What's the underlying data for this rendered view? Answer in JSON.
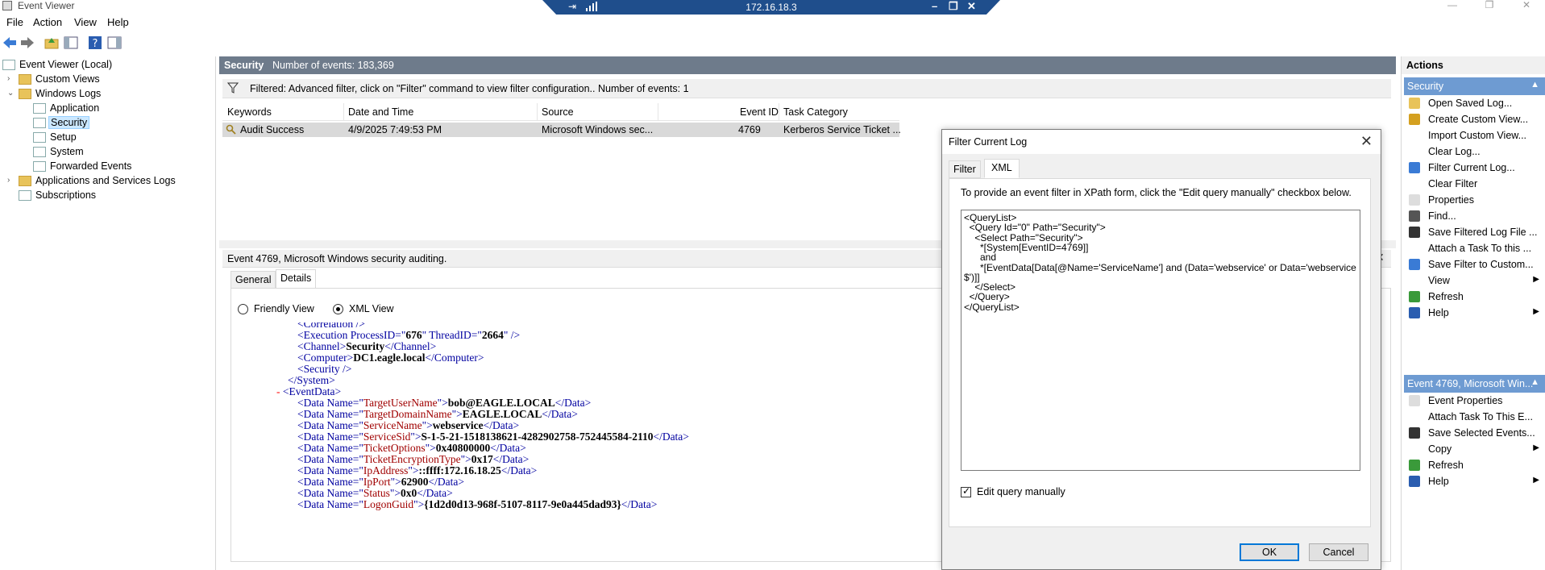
{
  "window": {
    "title": "Event Viewer"
  },
  "remote": {
    "host": "172.16.18.3"
  },
  "menu": [
    "File",
    "Action",
    "View",
    "Help"
  ],
  "tree": {
    "root": "Event Viewer (Local)",
    "custom_views": "Custom Views",
    "windows_logs": "Windows Logs",
    "application": "Application",
    "security": "Security",
    "setup": "Setup",
    "system": "System",
    "forwarded": "Forwarded Events",
    "apps_services": "Applications and Services Logs",
    "subscriptions": "Subscriptions"
  },
  "center": {
    "log_name": "Security",
    "count_text": "Number of events: 183,369",
    "filter_text": "Filtered: Advanced filter, click on \"Filter\" command to view filter configuration.. Number of events: 1",
    "columns": [
      "Keywords",
      "Date and Time",
      "Source",
      "Event ID",
      "Task Category"
    ],
    "row": {
      "keywords": "Audit Success",
      "date": "4/9/2025 7:49:53 PM",
      "source": "Microsoft Windows sec...",
      "event_id": "4769",
      "task": "Kerberos Service Ticket ..."
    }
  },
  "detail": {
    "header": "Event 4769, Microsoft Windows security auditing.",
    "tab_general": "General",
    "tab_details": "Details",
    "friendly": "Friendly View",
    "xmlview": "XML View",
    "xml": {
      "correlation_tag": "<Correlation />",
      "exec_open": "<Execution ProcessID=\"",
      "pid": "676",
      "exec_mid": "\" ThreadID=\"",
      "tid": "2664",
      "exec_close": "\" />",
      "channel_open": "<Channel>",
      "channel": "Security",
      "channel_close": "</Channel>",
      "computer_open": "<Computer>",
      "computer": "DC1.eagle.local",
      "computer_close": "</Computer>",
      "security_tag": "<Security />",
      "system_close": "</System>",
      "minus": "-",
      "eventdata_open": "<EventData>",
      "data": [
        {
          "name": "TargetUserName",
          "value": "bob@EAGLE.LOCAL"
        },
        {
          "name": "TargetDomainName",
          "value": "EAGLE.LOCAL"
        },
        {
          "name": "ServiceName",
          "value": "webservice"
        },
        {
          "name": "ServiceSid",
          "value": "S-1-5-21-1518138621-4282902758-752445584-2110"
        },
        {
          "name": "TicketOptions",
          "value": "0x40800000"
        },
        {
          "name": "TicketEncryptionType",
          "value": "0x17"
        },
        {
          "name": "IpAddress",
          "value": "::ffff:172.16.18.25"
        },
        {
          "name": "IpPort",
          "value": "62900"
        },
        {
          "name": "Status",
          "value": "0x0"
        },
        {
          "name": "LogonGuid",
          "value": "{1d2d0d13-968f-5107-8117-9e0a445dad93}"
        }
      ],
      "data_open": "<Data Name=\"",
      "data_mid": "\">",
      "data_close": "</Data>"
    }
  },
  "actions": {
    "header": "Actions",
    "section1": "Security",
    "items1": [
      "Open Saved Log...",
      "Create Custom View...",
      "Import Custom View...",
      "Clear Log...",
      "Filter Current Log...",
      "Clear Filter",
      "Properties",
      "Find...",
      "Save Filtered Log File ...",
      "Attach a Task To this ...",
      "Save Filter to Custom...",
      "View",
      "Refresh",
      "Help"
    ],
    "section2": "Event 4769, Microsoft Win...",
    "items2": [
      "Event Properties",
      "Attach Task To This E...",
      "Save Selected Events...",
      "Copy",
      "Refresh",
      "Help"
    ]
  },
  "dialog": {
    "title": "Filter Current Log",
    "tab_filter": "Filter",
    "tab_xml": "XML",
    "hint": "To provide an event filter in XPath form, click the \"Edit query manually\" checkbox below.",
    "query": [
      "<QueryList>",
      "  <Query Id=\"0\" Path=\"Security\">",
      "    <Select Path=\"Security\">",
      "      *[System[EventID=4769]]",
      "      and",
      "      *[EventData[Data[@Name='ServiceName'] and (Data='webservice' or Data='webservice",
      "$')]]",
      "    </Select>",
      "  </Query>",
      "</QueryList>"
    ],
    "edit_manually": "Edit query manually",
    "ok": "OK",
    "cancel": "Cancel"
  },
  "colors": {
    "header_bg": "#6e7b8b",
    "section_bg": "#6e9bd2",
    "rdp_bar": "#1f4e8c"
  }
}
